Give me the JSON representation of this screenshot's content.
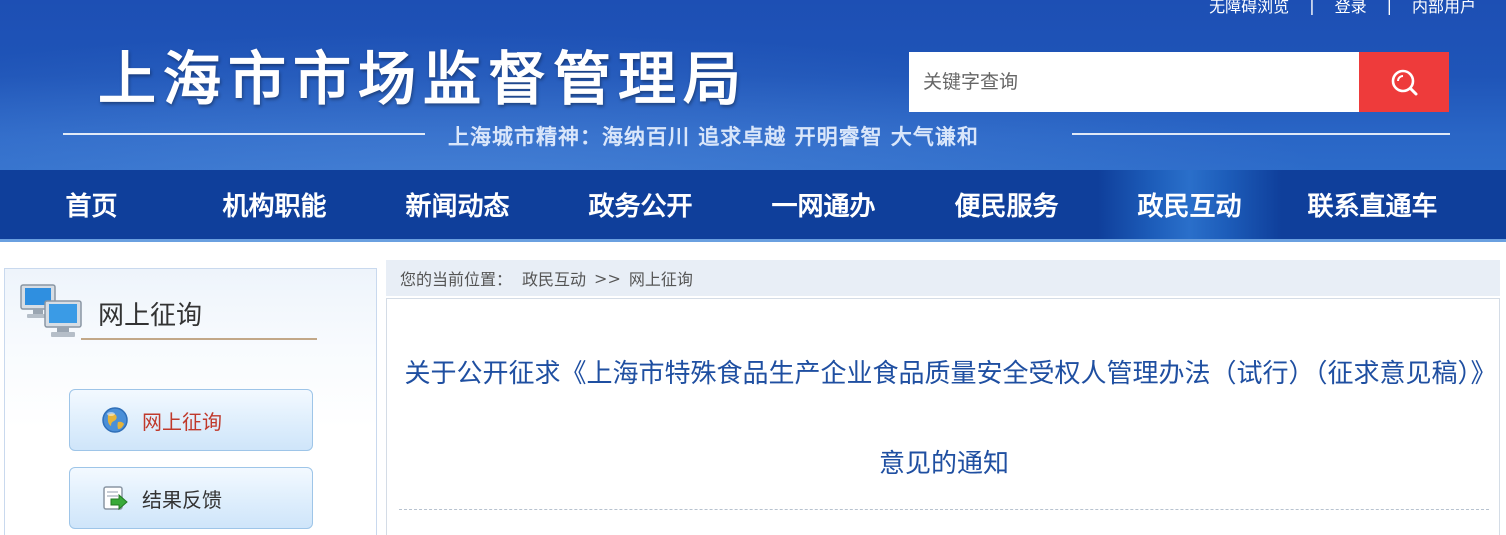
{
  "header": {
    "site_title": "上海市市场监督管理局",
    "slogan": "上海城市精神：海纳百川  追求卓越  开明睿智  大气谦和",
    "top_links": [
      "无障碍浏览",
      "登录",
      "内部用户"
    ],
    "search": {
      "placeholder": "关键字查询",
      "button_icon": "search-icon"
    }
  },
  "nav": {
    "items": [
      "首页",
      "机构职能",
      "新闻动态",
      "政务公开",
      "一网通办",
      "便民服务",
      "政民互动",
      "联系直通车"
    ],
    "active": "政民互动"
  },
  "sidebar": {
    "title": "网上征询",
    "title_icon": "computers-icon",
    "buttons": [
      {
        "label": "网上征询",
        "icon": "globe-icon",
        "color": "#c0392b"
      },
      {
        "label": "结果反馈",
        "icon": "arrow-right-icon",
        "color": "#333333"
      }
    ]
  },
  "breadcrumb": {
    "prefix": "您的当前位置：",
    "items": [
      "政民互动",
      "网上征询"
    ],
    "separator": ">>"
  },
  "article": {
    "title": "关于公开征求《上海市特殊食品生产企业食品质量安全受权人管理办法（试行）（征求意见稿）》意见的通知"
  },
  "colors": {
    "header_blue": "#1f55b8",
    "nav_blue": "#0f3f9b",
    "search_red": "#ee3b3b",
    "title_blue": "#1f4fa1"
  }
}
